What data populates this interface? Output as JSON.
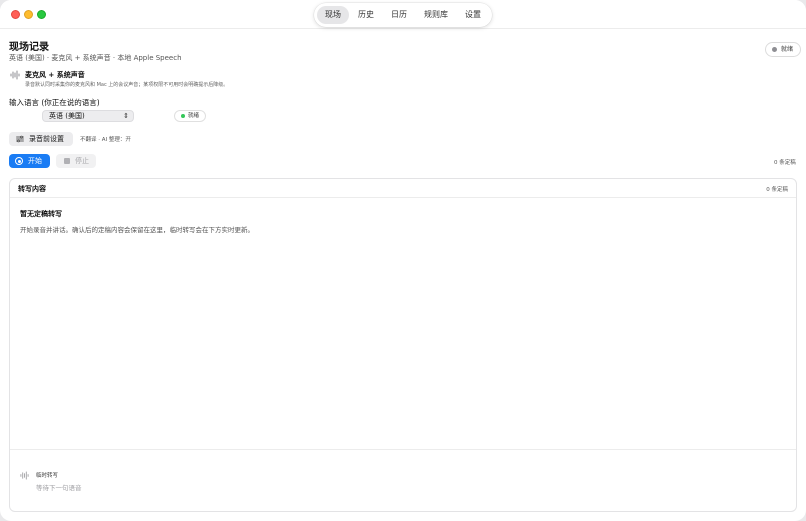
{
  "toolbar": {
    "tabs": [
      {
        "label": "现场",
        "active": true
      },
      {
        "label": "历史",
        "active": false
      },
      {
        "label": "日历",
        "active": false
      },
      {
        "label": "规则库",
        "active": false
      },
      {
        "label": "设置",
        "active": false
      }
    ]
  },
  "header": {
    "title": "现场记录",
    "subtitle": "英语 (美国) · 麦克风 + 系统声音 · 本地 Apple Speech",
    "status": "就绪"
  },
  "source": {
    "icon": "waveform-icon",
    "title": "麦克风 + 系统声音",
    "description": "录音默认同时采集你的麦克风和 Mac 上的会议声音；某项权限不可用时会明确提示后降级。"
  },
  "language": {
    "label": "输入语言 (你正在说的语言)",
    "selected": "英语 (美国)",
    "status": "就绪"
  },
  "presettings": {
    "button_label": "录音前设置",
    "note": "不翻译 · AI 整理：开"
  },
  "controls": {
    "start_label": "开始",
    "stop_label": "停止",
    "count": "0 条定稿"
  },
  "transcript": {
    "title": "转写内容",
    "count": "0 条定稿",
    "empty_title": "暂无定稿转写",
    "empty_desc": "开始录音并讲话。确认后的定稿内容会保留在这里，临时转写会在下方实时更新。",
    "live_title": "临时转写",
    "live_desc": "等待下一句语音"
  },
  "colors": {
    "accent": "#1a7cf4",
    "ready_green": "#34c759",
    "idle_gray": "#8e8e93"
  }
}
